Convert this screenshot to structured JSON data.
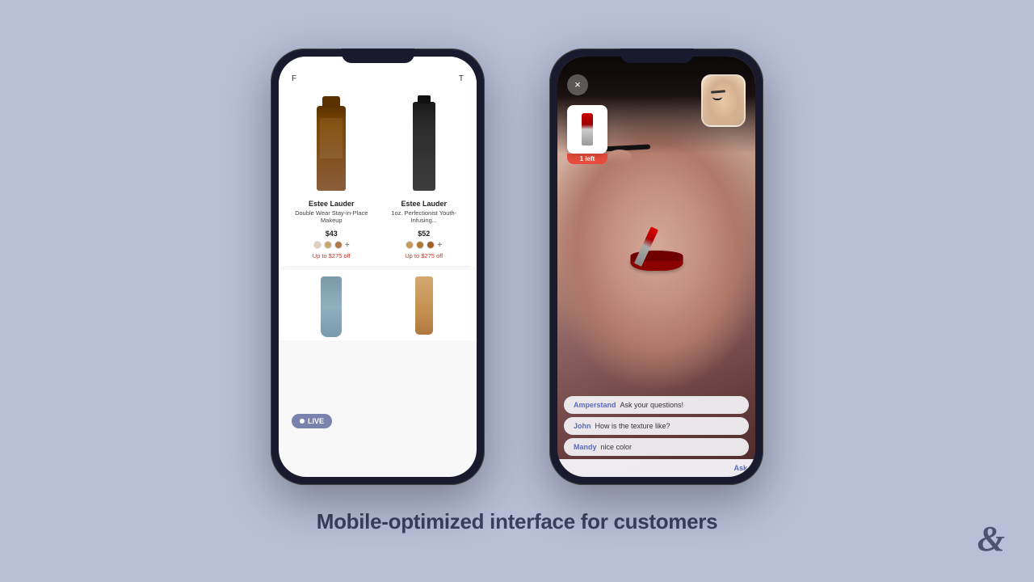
{
  "page": {
    "background": "#b8c0d8",
    "caption": "Mobile-optimized interface for customers"
  },
  "left_phone": {
    "header": {
      "left_text": "F",
      "right_text": "T"
    },
    "products": [
      {
        "brand": "Estee Lauder",
        "name": "Double Wear Stay-in-Place Makeup",
        "price": "$43",
        "discount": "Up to $275 off",
        "swatches": [
          "#e0d0c0",
          "#c8a870",
          "#b07848",
          "#906030"
        ]
      },
      {
        "brand": "Estee Lauder",
        "name": "1oz. Perfectionist Youth-Infusing...",
        "price": "$52",
        "discount": "Up to $275 off",
        "swatches": [
          "#c89858",
          "#b87838",
          "#a06028",
          "#886018"
        ]
      }
    ],
    "live_badge": "LIVE"
  },
  "right_phone": {
    "close_label": "×",
    "product_badge": "1 left",
    "chat_messages": [
      {
        "username": "Amperstand",
        "text": "Ask your questions!"
      },
      {
        "username": "John",
        "text": "How is the texture like?"
      },
      {
        "username": "Mandy",
        "text": "nice color"
      }
    ],
    "input_placeholder": "",
    "ask_button_label": "Ask"
  },
  "brand": {
    "symbol": "&"
  }
}
